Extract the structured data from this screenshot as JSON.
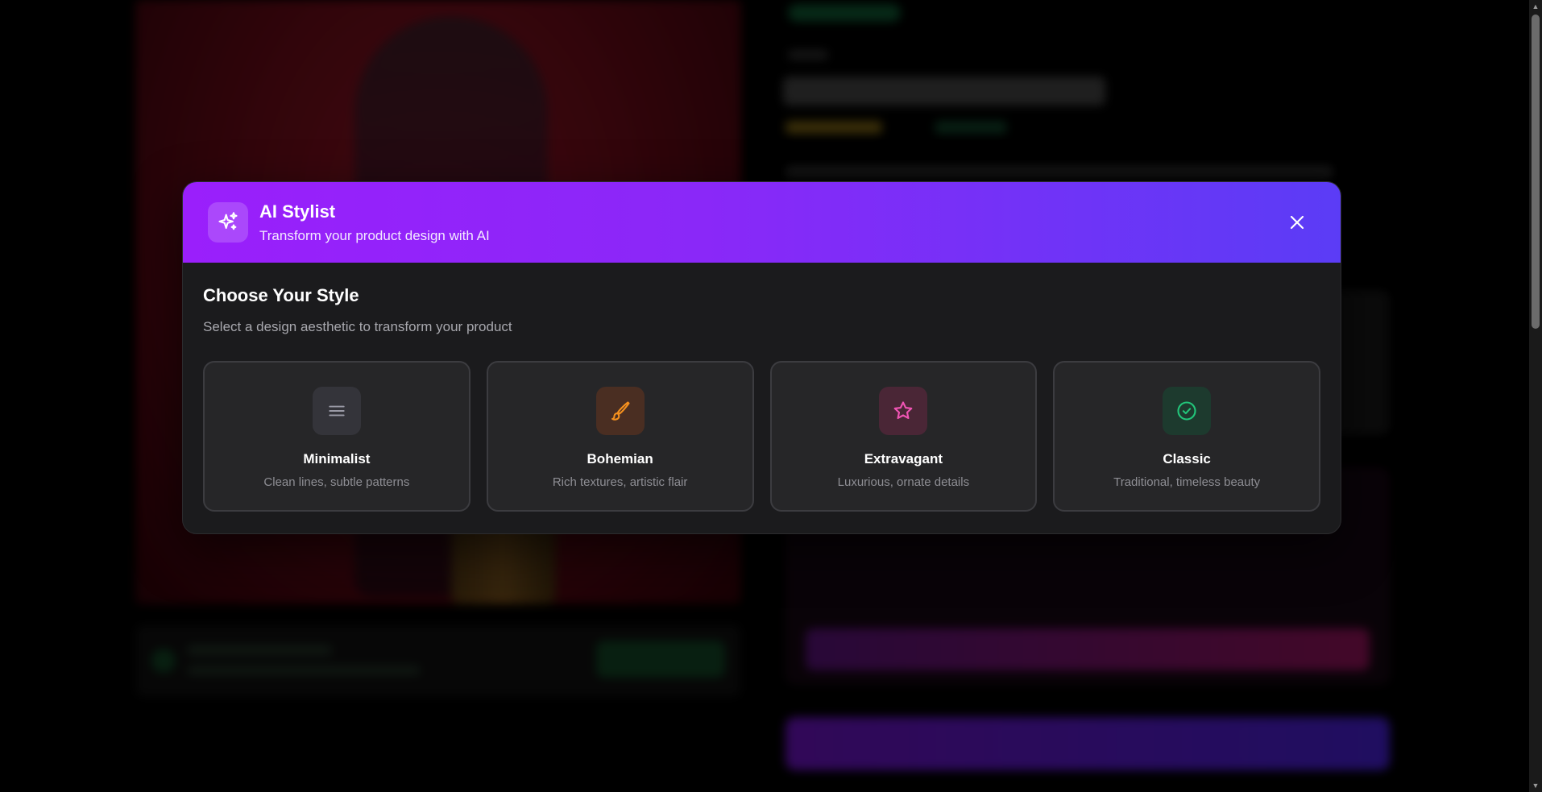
{
  "modal": {
    "title": "AI Stylist",
    "subtitle": "Transform your product design with AI",
    "heading": "Choose Your Style",
    "description": "Select a design aesthetic to transform your product",
    "header_gradient": [
      "#9a1ffb",
      "#5b3cf6"
    ],
    "header_icon": "sparkles-icon",
    "close_icon": "close-icon"
  },
  "styles": [
    {
      "title": "Minimalist",
      "description": "Clean lines, subtle patterns",
      "icon": "menu-lines-icon",
      "accent": "#9a9aa6",
      "icon_bg": "#34343a"
    },
    {
      "title": "Bohemian",
      "description": "Rich textures, artistic flair",
      "icon": "paintbrush-icon",
      "accent": "#f5901e",
      "icon_bg": "#4a2e22"
    },
    {
      "title": "Extravagant",
      "description": "Luxurious, ornate details",
      "icon": "star-icon",
      "accent": "#f054b4",
      "icon_bg": "#4a2636"
    },
    {
      "title": "Classic",
      "description": "Traditional, timeless beauty",
      "icon": "check-circle-icon",
      "accent": "#22c57a",
      "icon_bg": "#1d3a2e"
    }
  ]
}
